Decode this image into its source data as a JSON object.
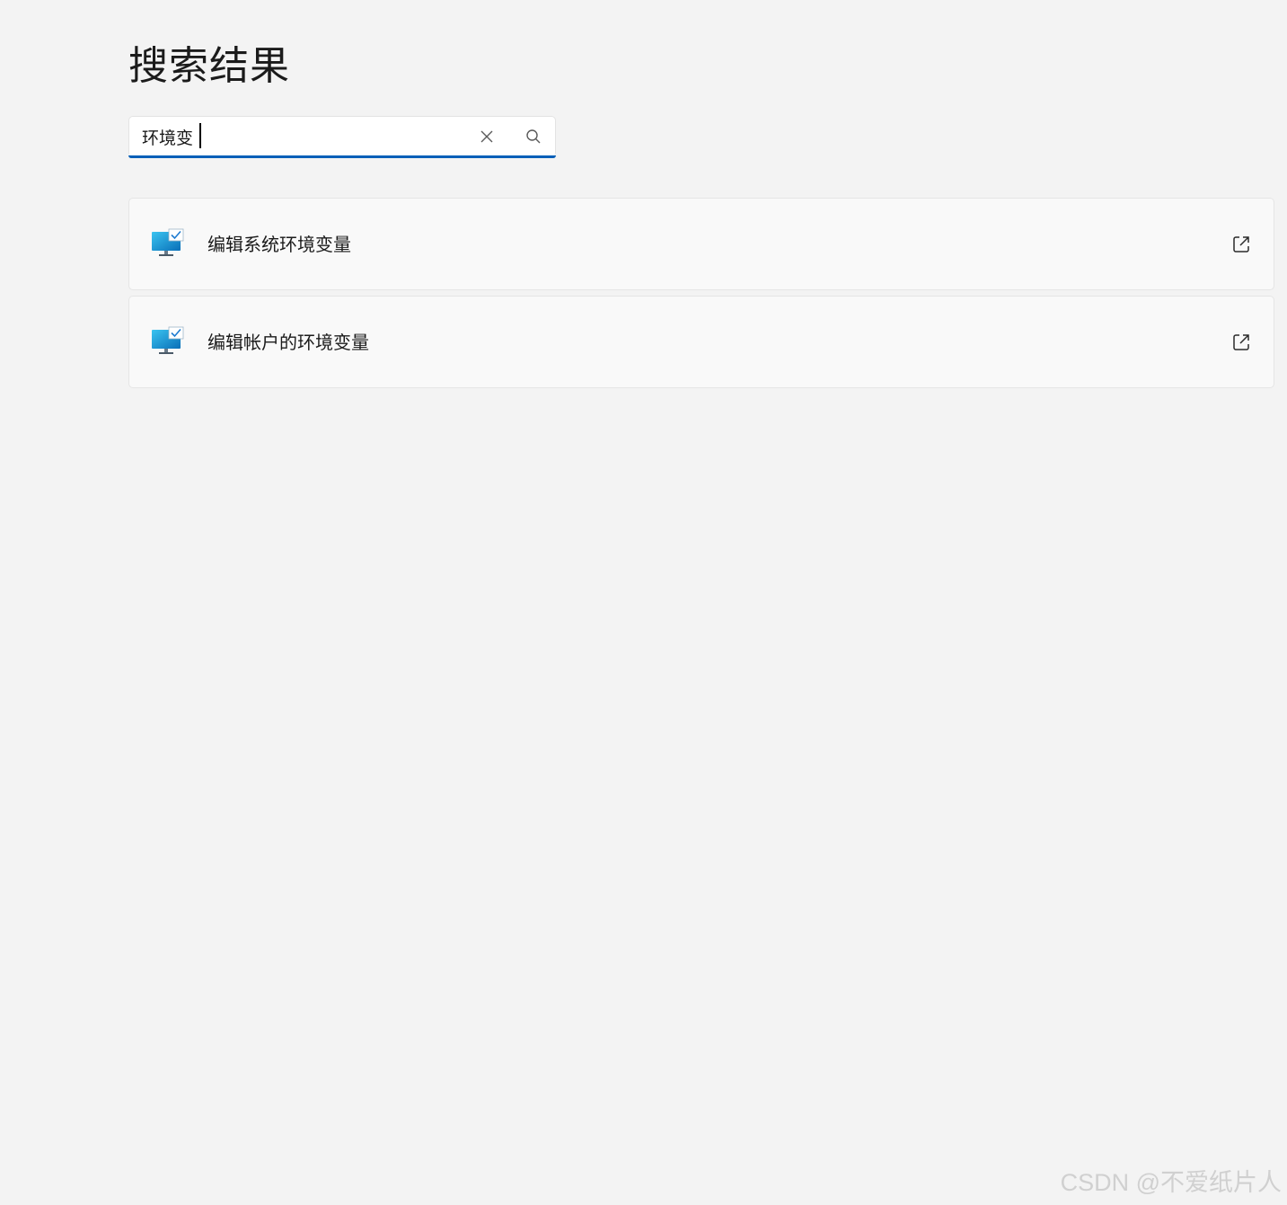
{
  "page": {
    "title": "搜索结果"
  },
  "search": {
    "value": "环境变",
    "clear_icon": "close-icon",
    "search_icon": "search-icon"
  },
  "results": [
    {
      "label": "编辑系统环境变量",
      "icon": "computer-settings-icon",
      "action_icon": "open-external-icon"
    },
    {
      "label": "编辑帐户的环境变量",
      "icon": "computer-settings-icon",
      "action_icon": "open-external-icon"
    }
  ],
  "watermark": "CSDN @不爱纸片人",
  "colors": {
    "background": "#f3f3f3",
    "accent": "#005fb8",
    "card": "#f9f9f9"
  }
}
